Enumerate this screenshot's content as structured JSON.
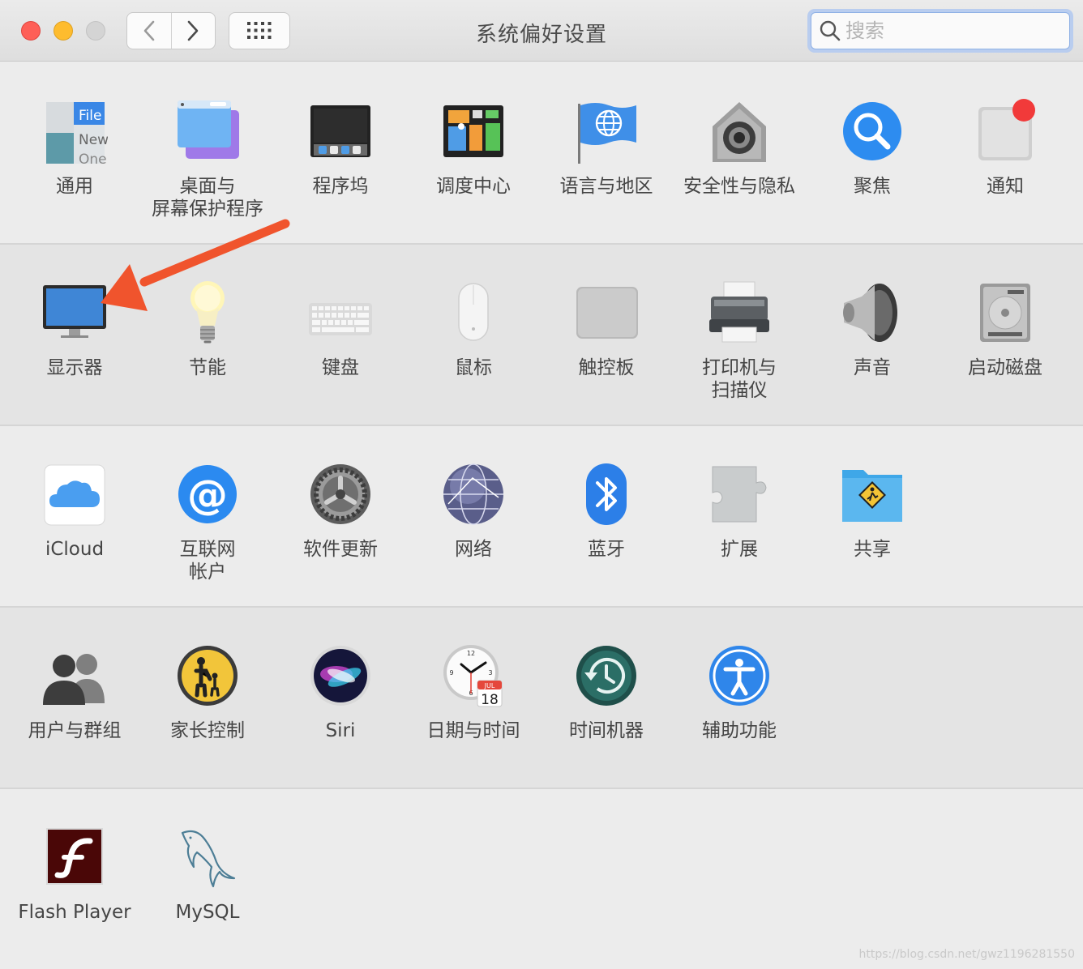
{
  "window": {
    "title": "系统偏好设置"
  },
  "search": {
    "placeholder": "搜索"
  },
  "rows": [
    [
      {
        "label": "通用",
        "icon": "general-icon"
      },
      {
        "label": "桌面与\n屏幕保护程序",
        "icon": "desktop-screensaver-icon"
      },
      {
        "label": "程序坞",
        "icon": "dock-icon"
      },
      {
        "label": "调度中心",
        "icon": "mission-control-icon"
      },
      {
        "label": "语言与地区",
        "icon": "language-region-icon"
      },
      {
        "label": "安全性与隐私",
        "icon": "security-privacy-icon"
      },
      {
        "label": "聚焦",
        "icon": "spotlight-icon"
      },
      {
        "label": "通知",
        "icon": "notifications-icon"
      }
    ],
    [
      {
        "label": "显示器",
        "icon": "displays-icon"
      },
      {
        "label": "节能",
        "icon": "energy-saver-icon"
      },
      {
        "label": "键盘",
        "icon": "keyboard-icon"
      },
      {
        "label": "鼠标",
        "icon": "mouse-icon"
      },
      {
        "label": "触控板",
        "icon": "trackpad-icon"
      },
      {
        "label": "打印机与\n扫描仪",
        "icon": "printers-scanners-icon"
      },
      {
        "label": "声音",
        "icon": "sound-icon"
      },
      {
        "label": "启动磁盘",
        "icon": "startup-disk-icon"
      }
    ],
    [
      {
        "label": "iCloud",
        "icon": "icloud-icon"
      },
      {
        "label": "互联网\n帐户",
        "icon": "internet-accounts-icon"
      },
      {
        "label": "软件更新",
        "icon": "software-update-icon"
      },
      {
        "label": "网络",
        "icon": "network-icon"
      },
      {
        "label": "蓝牙",
        "icon": "bluetooth-icon"
      },
      {
        "label": "扩展",
        "icon": "extensions-icon"
      },
      {
        "label": "共享",
        "icon": "sharing-icon"
      }
    ],
    [
      {
        "label": "用户与群组",
        "icon": "users-groups-icon"
      },
      {
        "label": "家长控制",
        "icon": "parental-controls-icon"
      },
      {
        "label": "Siri",
        "icon": "siri-icon"
      },
      {
        "label": "日期与时间",
        "icon": "date-time-icon"
      },
      {
        "label": "时间机器",
        "icon": "time-machine-icon"
      },
      {
        "label": "辅助功能",
        "icon": "accessibility-icon"
      }
    ],
    [
      {
        "label": "Flash Player",
        "icon": "flash-player-icon"
      },
      {
        "label": "MySQL",
        "icon": "mysql-icon"
      }
    ]
  ],
  "calendar": {
    "month": "JUL",
    "day": "18"
  },
  "watermark": "https://blog.csdn.net/gwz1196281550",
  "colors": {
    "accent": "#3e8bf0",
    "annotation_arrow": "#f0542d"
  }
}
